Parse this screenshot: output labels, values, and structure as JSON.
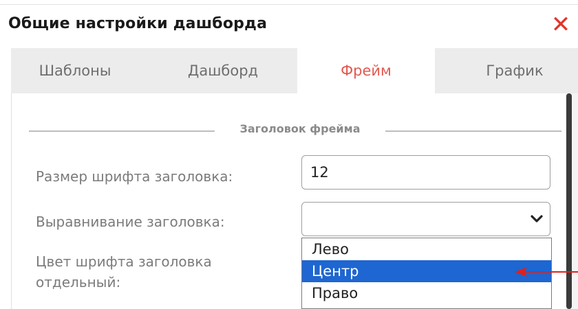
{
  "dialog": {
    "title": "Общие настройки дашборда",
    "close_icon": "close-icon",
    "close_glyph": "✕"
  },
  "tabs": [
    {
      "label": "Шаблоны",
      "active": false
    },
    {
      "label": "Дашборд",
      "active": false
    },
    {
      "label": "Фрейм",
      "active": true
    },
    {
      "label": "График",
      "active": false
    }
  ],
  "section": {
    "legend": "Заголовок фрейма"
  },
  "fields": {
    "font_size": {
      "label": "Размер шрифта заголовка:",
      "value": "12"
    },
    "alignment": {
      "label": "Выравнивание заголовка:",
      "value": "",
      "options": [
        {
          "label": "Лево",
          "selected": false
        },
        {
          "label": "Центр",
          "selected": true
        },
        {
          "label": "Право",
          "selected": false
        }
      ]
    },
    "separate_font_color": {
      "label": "Цвет шрифта заголовка отдельный:"
    }
  },
  "colors": {
    "accent": "#e25a51",
    "close": "#e2342b",
    "selection": "#1e66d1",
    "annotation_arrow": "#e0201b"
  }
}
